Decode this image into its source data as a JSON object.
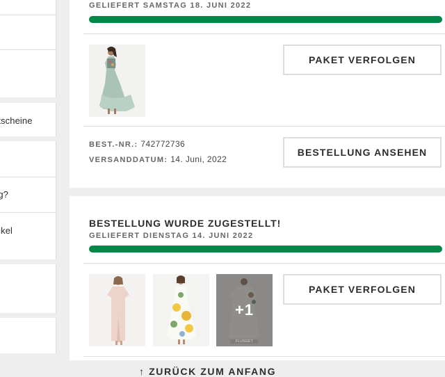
{
  "sidebar": {
    "items": [
      {
        "label": ""
      },
      {
        "label": ""
      },
      {
        "label": "utscheine"
      },
      {
        "label": ""
      },
      {
        "label": "ng?"
      },
      {
        "label": "rtikel"
      },
      {
        "label": ""
      },
      {
        "label": ""
      }
    ]
  },
  "order1": {
    "delivered_sub": "GELIEFERT SAMSTAG 18. JUNI 2022",
    "progress": 1.0,
    "track_button": "PAKET VERFOLGEN",
    "order_no_label": "BEST.-NR.:",
    "order_no_value": "742772736",
    "ship_date_label": "VERSANDDATUM:",
    "ship_date_value": "14. Juni, 2022",
    "view_button": "BESTELLUNG ANSEHEN"
  },
  "order2": {
    "title": "BESTELLUNG WURDE ZUGESTELLT!",
    "delivered_sub": "GELIEFERT DIENSTAG 14. JUNI 2022",
    "progress": 1.0,
    "track_button": "PAKET VERFOLGEN",
    "more_count": "+1",
    "thumb_caption": "FLUSGET"
  },
  "footer": {
    "back_to_top": "↑ ZURÜCK ZUM ANFANG"
  },
  "colors": {
    "progress": "#018849",
    "background": "#eeeeee",
    "card": "#ffffff",
    "border": "#dddddd"
  }
}
